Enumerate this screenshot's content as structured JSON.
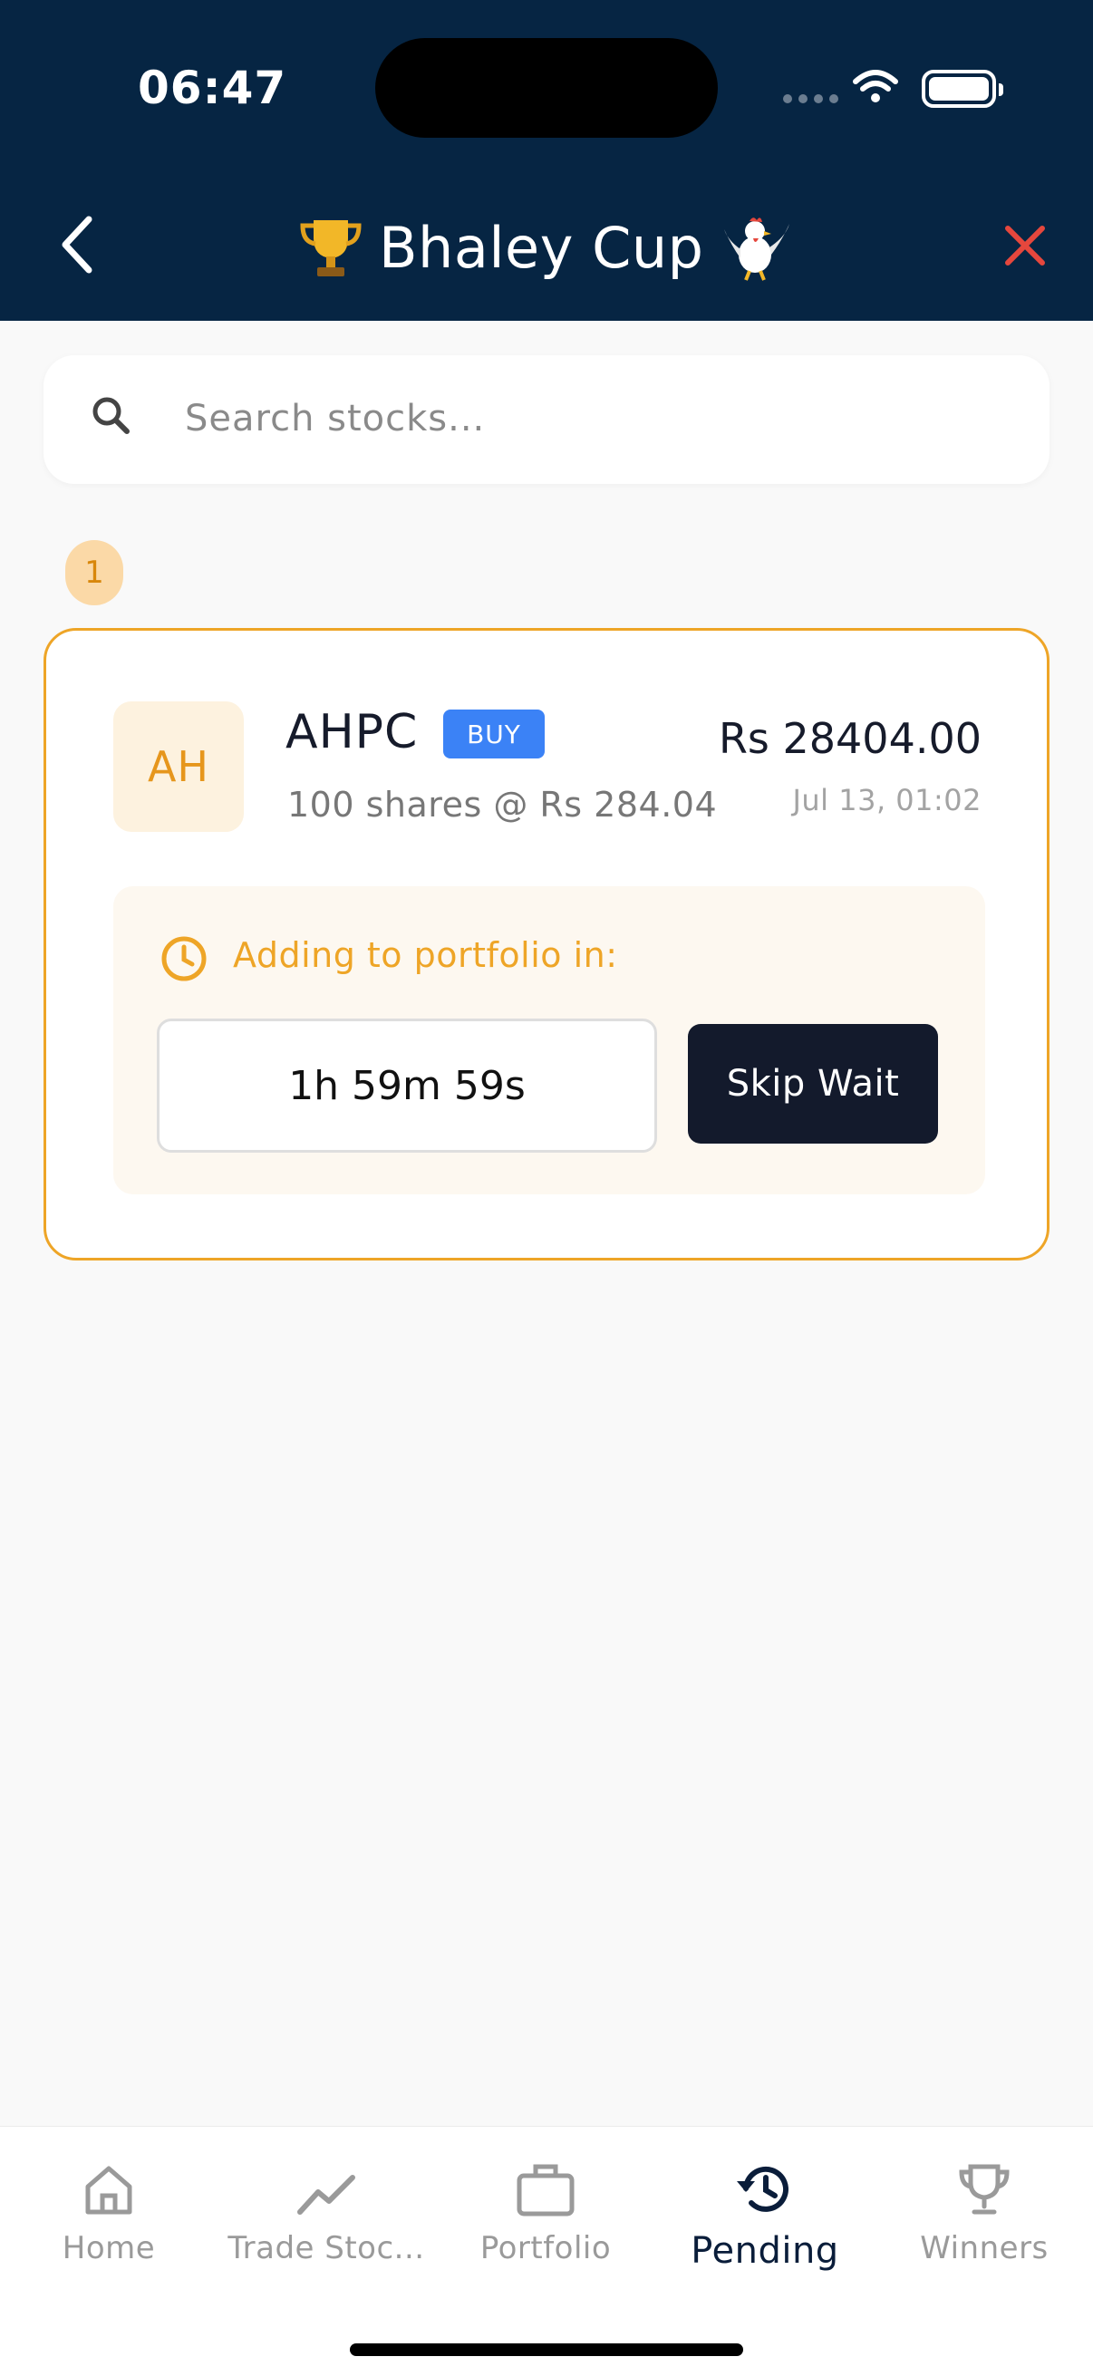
{
  "status_bar": {
    "time": "06:47"
  },
  "header": {
    "title": "Bhaley Cup"
  },
  "search": {
    "placeholder": "Search stocks..."
  },
  "pending_count": "1",
  "order": {
    "avatar_initials": "AH",
    "ticker": "AHPC",
    "side": "BUY",
    "shares_text": "100 shares @ Rs 284.04",
    "amount": "Rs 28404.00",
    "date": "Jul 13, 01:02",
    "adding_label": "Adding to portfolio in:",
    "countdown": "1h 59m 59s",
    "skip_label": "Skip Wait"
  },
  "tabs": [
    {
      "label": "Home",
      "icon": "home-icon",
      "active": false
    },
    {
      "label": "Trade Stoc...",
      "icon": "trending-up-icon",
      "active": false
    },
    {
      "label": "Portfolio",
      "icon": "briefcase-icon",
      "active": false
    },
    {
      "label": "Pending",
      "icon": "history-icon",
      "active": true
    },
    {
      "label": "Winners",
      "icon": "trophy-icon",
      "active": false
    }
  ],
  "colors": {
    "header_bg": "#062543",
    "accent_orange": "#eea527",
    "close_red": "#e5473d",
    "buy_blue": "#3b82f6",
    "dark_button": "#131a2c"
  }
}
